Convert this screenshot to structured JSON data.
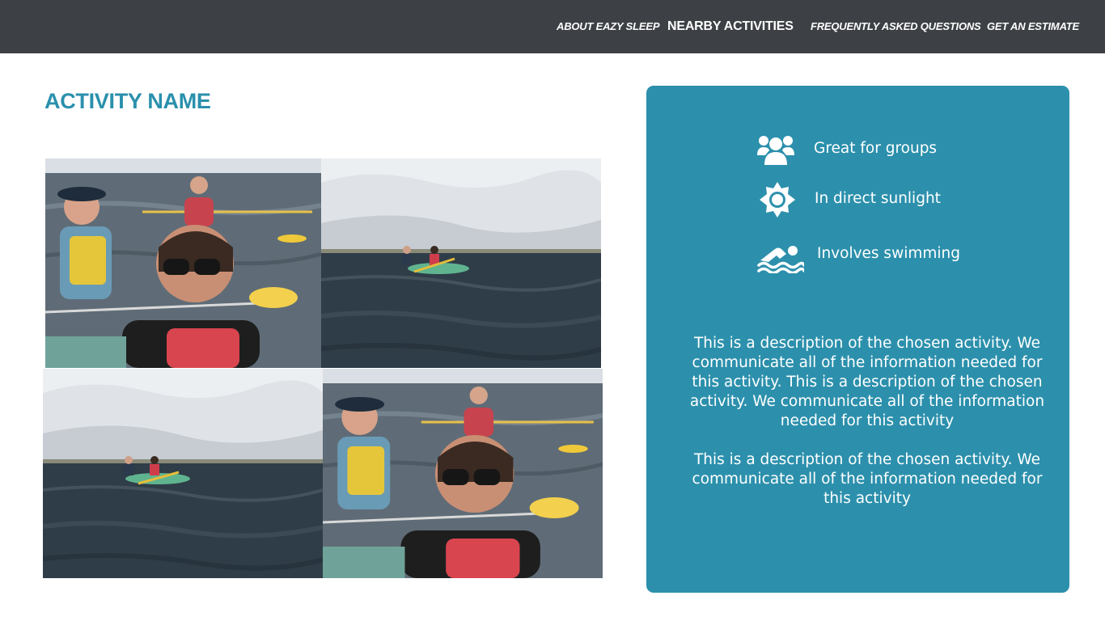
{
  "nav": {
    "items": [
      {
        "label": "ABOUT EAZY SLEEP",
        "active": false
      },
      {
        "label": "NEARBY ACTIVITIES",
        "active": true
      },
      {
        "label": "FREQUENTLY ASKED QUESTIONS",
        "active": false
      },
      {
        "label": "GET AN ESTIMATE",
        "active": false
      }
    ]
  },
  "activity": {
    "title": "ACTIVITY NAME",
    "photos": [
      {
        "subject": "kayak-selfie"
      },
      {
        "subject": "kayak-distance"
      },
      {
        "subject": "kayak-distance"
      },
      {
        "subject": "kayak-selfie"
      }
    ]
  },
  "details": {
    "features": [
      {
        "icon": "group-icon",
        "label": "Great for groups"
      },
      {
        "icon": "sun-icon",
        "label": "In direct sunlight"
      },
      {
        "icon": "swimming-icon",
        "label": "Involves swimming"
      }
    ],
    "description_1": "This is a description of the chosen activity. We communicate all of the information needed for this activity. This is a description of the chosen activity. We communicate all of the information needed for this activity",
    "description_2": "This is a description of the chosen activity. We communicate all of the information needed for this activity"
  },
  "colors": {
    "topbar": "#3d4145",
    "accent": "#2a90ac",
    "panel": "#2c90ac"
  }
}
